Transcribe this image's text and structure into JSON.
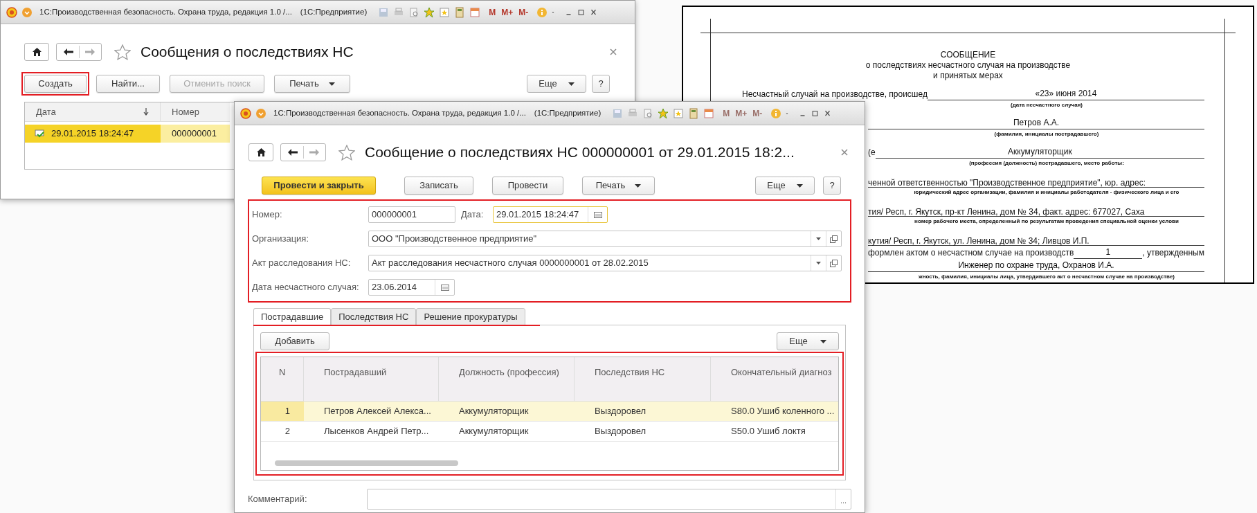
{
  "list_window": {
    "title_bar": {
      "title": "1С:Производственная безопасность. Охрана труда, редакция 1.0 /...",
      "app": "(1С:Предприятие)",
      "memory_buttons": [
        "M",
        "M+",
        "M-"
      ],
      "memory_enabled": true
    },
    "title": "Сообщения о последствиях НС",
    "toolbar": [
      {
        "label": "Создать",
        "kind": "plain",
        "highlighted": true,
        "disabled": false,
        "dropdown": false
      },
      {
        "label": "Найти...",
        "kind": "plain",
        "highlighted": false,
        "disabled": false,
        "dropdown": false
      },
      {
        "label": "Отменить поиск",
        "kind": "plain",
        "highlighted": false,
        "disabled": true,
        "dropdown": false
      },
      {
        "label": "Печать",
        "kind": "plain",
        "highlighted": false,
        "disabled": false,
        "dropdown": true
      }
    ],
    "more_button": "Еще",
    "help_button": "?",
    "table": {
      "columns": [
        {
          "label": "Дата",
          "sorted": true
        },
        {
          "label": "Номер",
          "sorted": false
        }
      ],
      "rows": [
        {
          "cells": [
            "29.01.2015 18:24:47",
            "000000001"
          ],
          "selected": true
        }
      ]
    }
  },
  "document_window": {
    "title_bar": {
      "title": "1С:Производственная безопасность. Охрана труда, редакция 1.0 /...",
      "app": "(1С:Предприятие)",
      "memory_buttons": [
        "M",
        "M+",
        "M-"
      ],
      "memory_enabled": false
    },
    "title": "Сообщение о последствиях НС 000000001 от 29.01.2015 18:2...",
    "toolbar": [
      {
        "label": "Провести и закрыть",
        "kind": "primary",
        "highlighted": false,
        "disabled": false,
        "dropdown": false
      },
      {
        "label": "Записать",
        "kind": "plain",
        "highlighted": false,
        "disabled": false,
        "dropdown": false
      },
      {
        "label": "Провести",
        "kind": "plain",
        "highlighted": false,
        "disabled": false,
        "dropdown": false
      },
      {
        "label": "Печать",
        "kind": "plain",
        "highlighted": false,
        "disabled": false,
        "dropdown": true
      }
    ],
    "more_button": "Еще",
    "help_button": "?",
    "fields_highlighted": true,
    "number": {
      "label": "Номер:",
      "value": "000000001"
    },
    "date": {
      "label": "Дата:",
      "value": "29.01.2015 18:24:47",
      "focused": true
    },
    "organization": {
      "label": "Организация:",
      "value": "ООО \"Производственное предприятие\""
    },
    "investigation_act": {
      "label": "Акт расследования НС:",
      "value": "Акт расследования несчастного случая 0000000001 от 28.02.2015"
    },
    "accident_date": {
      "label": "Дата несчастного случая:",
      "value": "23.06.2014"
    },
    "tabs_underlined": true,
    "tabs": [
      {
        "label": "Пострадавшие",
        "selected": true
      },
      {
        "label": "Последствия НС",
        "selected": false
      },
      {
        "label": "Решение прокуратуры",
        "selected": false
      }
    ],
    "add_button": "Добавить",
    "table_more_button": "Еще",
    "table": {
      "highlighted": true,
      "columns": [
        "N",
        "Пострадавший",
        "Должность (профессия)",
        "Последствия НС",
        "Окончательный диагноз"
      ],
      "rows": [
        {
          "cells": [
            "1",
            "Петров Алексей Алекса...",
            "Аккумуляторщик",
            "Выздоровел",
            "S80.0 Ушиб коленного ..."
          ],
          "selected": true
        },
        {
          "cells": [
            "2",
            "Лысенков Андрей Петр...",
            "Аккумуляторщик",
            "Выздоровел",
            "S50.0 Ушиб локтя"
          ],
          "selected": false
        }
      ]
    },
    "comment": {
      "label": "Комментарий:",
      "choose_button": "..."
    }
  },
  "printed_form": {
    "title": "СООБЩЕНИЕ",
    "subtitle_lines": [
      "о последствиях несчастного случая на производстве",
      "и принятых мерах"
    ],
    "lines": [
      {
        "kind": "fill",
        "label": "Несчастный случай на производстве, происшед",
        "value": "«23» июня 2014"
      },
      {
        "kind": "caption",
        "text": "(дата несчастного случая)"
      },
      {
        "kind": "fill",
        "value": "Петров А.А."
      },
      {
        "kind": "caption",
        "text": "(фамилия, инициалы пострадавшего)"
      },
      {
        "kind": "fill",
        "label": "(е",
        "value": "Аккумуляторщик"
      },
      {
        "kind": "caption",
        "text": "(профессия (должность) пострадавшего, место работы:"
      },
      {
        "kind": "text",
        "text": "ченной ответственностью \"Производственное предприятие\", юр. адрес:"
      },
      {
        "kind": "caption",
        "text": "юридический адрес организации, фамилия и инициалы работодателя - физического лица и его"
      },
      {
        "kind": "text",
        "text": "тия/ Респ, г. Якутск, пр-кт Ленина, дом № 34, факт. адрес: 677027, Саха"
      },
      {
        "kind": "caption",
        "text": "номер рабочего места, определенный по результатам проведения специальной оценки услови"
      },
      {
        "kind": "text",
        "text": "кутия/ Респ, г. Якутск, ул. Ленина, дом № 34; Ливцов И.П."
      },
      {
        "kind": "fill",
        "label": "формлен актом  о  несчастном  случае  на производств",
        "value": "1",
        "suffix": ", утвержденным"
      },
      {
        "kind": "fill",
        "value": "Инженер по охране труда, Охранов И.А."
      },
      {
        "kind": "caption",
        "text": "жность, фамилия, инициалы лица, утвердившего акт о несчастном случае на производстве)"
      }
    ]
  }
}
